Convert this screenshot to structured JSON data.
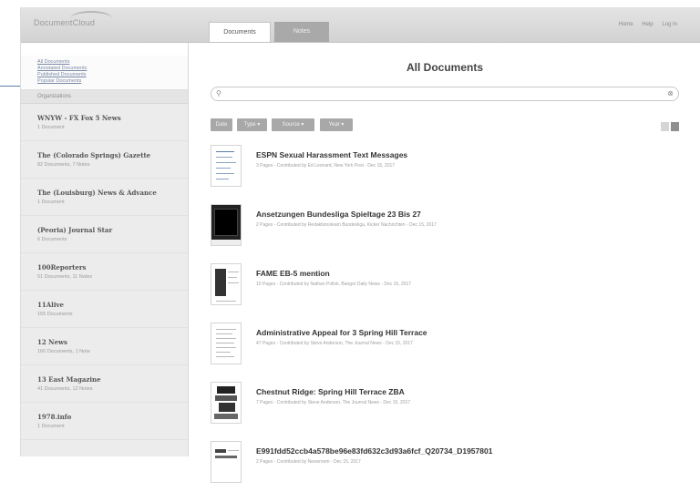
{
  "app": {
    "logo": "DocumentCloud"
  },
  "tabs": [
    {
      "label": "Documents",
      "active": true
    },
    {
      "label": "Notes",
      "active": false
    }
  ],
  "top_links": [
    "Home",
    "Help",
    "Log In"
  ],
  "sidebar": {
    "links": [
      "All Documents",
      "Annotated Documents",
      "Published Documents",
      "Popular Documents"
    ],
    "section_header": "Organizations",
    "organizations": [
      {
        "name": "WNYW - FX Fox 5 News",
        "stats": "1 Document"
      },
      {
        "name": "The (Colorado Springs) Gazette",
        "stats": "82 Documents, 7 Notes"
      },
      {
        "name": "The (Louisburg) News & Advance",
        "stats": "1 Document"
      },
      {
        "name": "(Peoria) Journal Star",
        "stats": "6 Documents"
      },
      {
        "name": "100Reporters",
        "stats": "51 Documents, 11 Notes"
      },
      {
        "name": "11Alive",
        "stats": "155 Documents"
      },
      {
        "name": "12 News",
        "stats": "160 Documents, 1 Note"
      },
      {
        "name": "13 East Magazine",
        "stats": "41 Documents, 12 Notes"
      },
      {
        "name": "1978.info",
        "stats": "1 Document"
      }
    ]
  },
  "main": {
    "title": "All Documents",
    "search": {
      "placeholder": ""
    },
    "filters": [
      "Date",
      "Type",
      "Source",
      "Year"
    ],
    "documents": [
      {
        "title": "ESPN Sexual Harassment Text Messages",
        "meta": "3 Pages - Contributed by Ed Leonard, New York Post - Dec 15, 2017"
      },
      {
        "title": "Ansetzungen Bundesliga Spieltage 23 Bis 27",
        "meta": "2 Pages - Contributed by Redaktionsteam Bundesliga, Kicker Nachrichten - Dec 15, 2017"
      },
      {
        "title": "FAME EB-5 mention",
        "meta": "10 Pages - Contributed by Nathan Pollok, Bangor Daily News - Dec 15, 2017"
      },
      {
        "title": "Administrative Appeal for 3 Spring Hill Terrace",
        "meta": "47 Pages - Contributed by Steve Anderson, The Journal News - Dec 15, 2017"
      },
      {
        "title": "Chestnut Ridge: Spring Hill Terrace ZBA",
        "meta": "7 Pages - Contributed by Steve Anderson, The Journal News - Dec 15, 2017"
      },
      {
        "title": "E991fdd52ccb4a578be96e83fd632c3d93a6fcf_Q20734_D1957801",
        "meta": "2 Pages - Contributed by Newsroom - Dec 15, 2017"
      }
    ]
  }
}
